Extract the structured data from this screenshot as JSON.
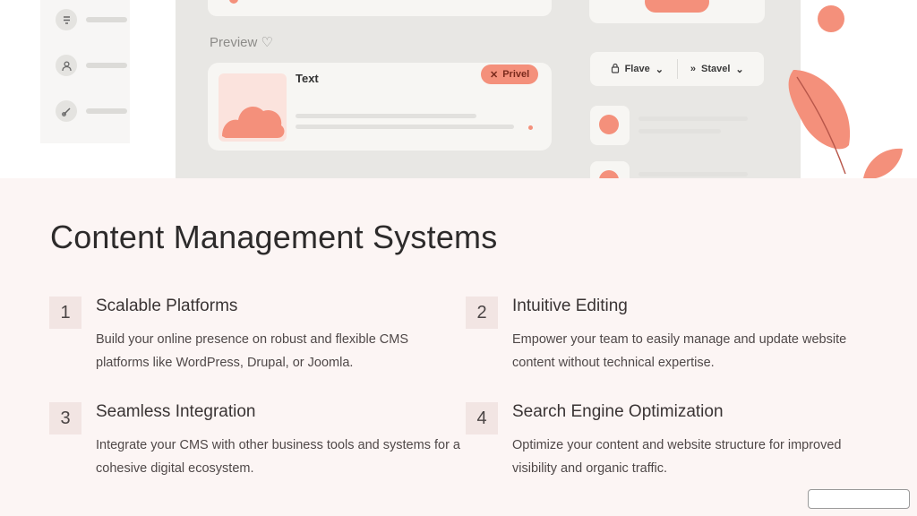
{
  "hero": {
    "preview_label": "Preview ♡",
    "card_text": "Text",
    "card_badge": "Privel",
    "toolbar": {
      "button_1": "Flave",
      "button_2": "Stavel"
    },
    "colors": {
      "accent": "#f4907b",
      "panel": "#e8e7e4"
    }
  },
  "title": "Content Management Systems",
  "features": [
    {
      "number": "1",
      "title": "Scalable Platforms",
      "description": "Build your online presence on robust and flexible CMS platforms like WordPress, Drupal, or Joomla."
    },
    {
      "number": "2",
      "title": "Intuitive Editing",
      "description": "Empower your team to easily manage and update website content without technical expertise."
    },
    {
      "number": "3",
      "title": "Seamless Integration",
      "description": "Integrate your CMS with other business tools and systems for a cohesive digital ecosystem."
    },
    {
      "number": "4",
      "title": "Search Engine Optimization",
      "description": "Optimize your content and website structure for improved visibility and organic traffic."
    }
  ]
}
